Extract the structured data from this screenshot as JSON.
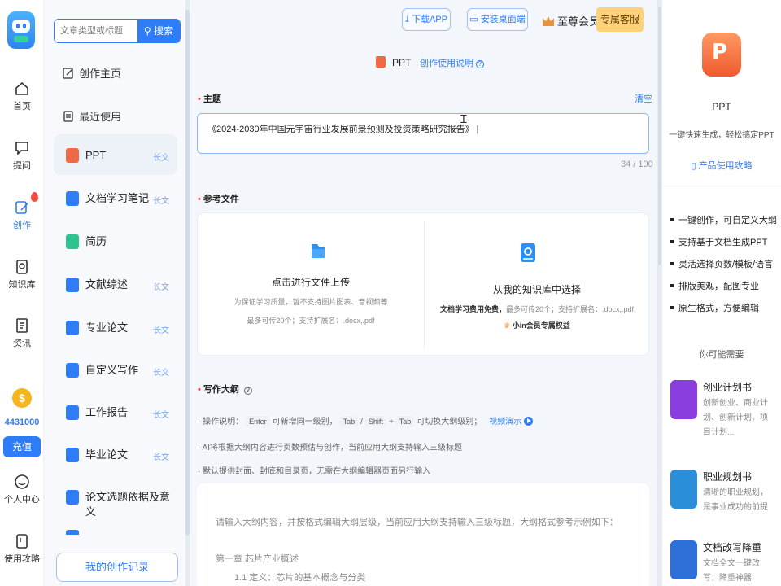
{
  "nav": {
    "items": [
      {
        "label": "首页",
        "icon": "home-icon"
      },
      {
        "label": "提问",
        "icon": "chat-icon"
      },
      {
        "label": "创作",
        "icon": "pen-icon"
      },
      {
        "label": "知识库",
        "icon": "knowledge-icon"
      },
      {
        "label": "资讯",
        "icon": "news-icon"
      },
      {
        "label": "个人中心",
        "icon": "user-icon"
      },
      {
        "label": "使用攻略",
        "icon": "guide-icon"
      }
    ],
    "coins": "4431000",
    "recharge": "充值"
  },
  "sidebar": {
    "search_placeholder": "文章类型或标题",
    "search_button": "搜索",
    "home": "创作主页",
    "recent": "最近使用",
    "items": [
      {
        "label": "PPT",
        "badge": "长文",
        "color": "#ed6a44"
      },
      {
        "label": "文档学习笔记",
        "badge": "长文",
        "color": "#2e7cf6"
      },
      {
        "label": "简历",
        "badge": "",
        "color": "#2ec28f"
      },
      {
        "label": "文献综述",
        "badge": "长文",
        "color": "#2e7cf6"
      },
      {
        "label": "专业论文",
        "badge": "长文",
        "color": "#2e7cf6"
      },
      {
        "label": "自定义写作",
        "badge": "长文",
        "color": "#2e7cf6"
      },
      {
        "label": "工作报告",
        "badge": "长文",
        "color": "#2e7cf6"
      },
      {
        "label": "毕业论文",
        "badge": "长文",
        "color": "#2e7cf6"
      },
      {
        "label": "论文选题依据及意义",
        "badge": "",
        "color": "#2e7cf6"
      }
    ],
    "record_button": "我的创作记录"
  },
  "header": {
    "download_app": "下载APP",
    "install_desktop": "安装桌面端",
    "vip": "至尊会员",
    "service": "专属客服"
  },
  "form": {
    "title": "PPT",
    "guide": "创作使用说明",
    "topic_label": "主题",
    "clear": "清空",
    "topic_value": "《2024-2030年中国元宇宙行业发展前景预测及投资策略研究报告》",
    "count": "34 / 100",
    "ref_label": "参考文件",
    "upload_title": "点击进行文件上传",
    "upload_note1": "为保证学习质量，暂不支持图片图表、音视频等",
    "upload_note2": "最多可传20个；支持扩展名：.docx,.pdf",
    "kb_title": "从我的知识库中选择",
    "kb_note_bold": "文档学习费用免费，",
    "kb_note": "最多可传20个；支持扩展名：.docx,.pdf",
    "kb_vip": "小in会员专属权益",
    "outline_label": "写作大纲",
    "op_prefix": "· 操作说明：",
    "key_enter": "Enter",
    "op_mid1": "可新增同一级别，",
    "key_tab": "Tab",
    "slash": "/",
    "key_shift": "Shift",
    "plus": "+",
    "key_tab2": "Tab",
    "op_mid2": "可切换大纲级别；",
    "video": "视频演示",
    "note2": "· AI将根据大纲内容进行页数预估与创作，当前应用大纲支持输入三级标题",
    "note3": "· 默认提供封面、封底和目录页，无需在大纲编辑器页面另行输入",
    "outline_hint": "请输入大纲内容，并按格式编辑大纲层级，当前应用大纲支持输入三级标题，大纲格式参考示例如下：",
    "outline_ex1": "第一章 芯片产业概述",
    "outline_ex2": "1.1 定义：芯片的基本概念与分类"
  },
  "right": {
    "title": "PPT",
    "sub": "一键快速生成，轻松搞定PPT",
    "guide": "产品使用攻略",
    "features": [
      "一键创作，可自定义大纲",
      "支持基于文档生成PPT",
      "灵活选择页数/模板/语言",
      "排版美观，配图专业",
      "原生格式，方便编辑"
    ],
    "maybe": "你可能需要",
    "cards": [
      {
        "title": "创业计划书",
        "desc": "创新创业、商业计划、创新计划、项目计划...",
        "color": "#8a3ee0",
        "icon": "business-plan-icon"
      },
      {
        "title": "职业规划书",
        "desc": "清晰的职业规划，是事业成功的前提",
        "color": "#2a8fd8",
        "icon": "career-plan-icon"
      },
      {
        "title": "文档改写降重",
        "desc": "文档全文一键改写，降重神器",
        "color": "#2e6fd8",
        "icon": "word-doc-icon"
      }
    ]
  }
}
